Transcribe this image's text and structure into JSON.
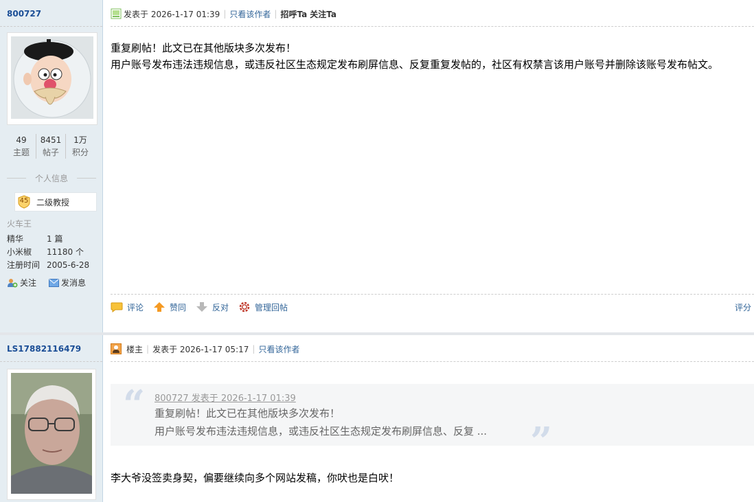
{
  "post1": {
    "author": {
      "username": "800727",
      "stats": [
        {
          "value": "49",
          "label": "主题"
        },
        {
          "value": "8451",
          "label": "帖子"
        },
        {
          "value": "1万",
          "label": "积分"
        }
      ],
      "section_header": "个人信息",
      "rank_level": "45",
      "rank_name": "二级教授",
      "title": "火车王",
      "info": [
        {
          "key": "精华",
          "value": "1 篇"
        },
        {
          "key": "小米椒",
          "value": "11180 个"
        },
        {
          "key": "注册时间",
          "value": "2005-6-28"
        }
      ],
      "follow_label": "关注",
      "message_label": "发消息"
    },
    "posted_at": "发表于 2026-1-17 01:39",
    "only_author": "只看该作者",
    "greet": "招呼Ta",
    "follow": "关注Ta",
    "body_lines": [
      "重复刷帖！此文已在其他版块多次发布！",
      "用户账号发布违法违规信息，或违反社区生态规定发布刷屏信息、反复重复发帖的，社区有权禁言该用户账号并删除该账号发布帖文。"
    ],
    "footer": {
      "comment": "评论",
      "like": "赞同",
      "oppose": "反对",
      "manage": "管理回帖",
      "rate": "评分"
    }
  },
  "post2": {
    "author": {
      "username": "LS17882116479"
    },
    "role": "楼主",
    "posted_at": "发表于 2026-1-17 05:17",
    "only_author": "只看该作者",
    "quote": {
      "meta": "800727 发表于 2026-1-17 01:39",
      "line1": "重复刷帖！此文已在其他版块多次发布！",
      "line2": "用户账号发布违法违规信息，或违反社区生态规定发布刷屏信息、反复 ..."
    },
    "body": "李大爷没签卖身契，偏要继续向多个网站发稿，你吠也是白吠！"
  },
  "icons": {
    "post_icon": "document-icon",
    "owner_icon": "thread-owner-icon",
    "comment_icon": "comment-icon",
    "like_icon": "thumb-up-arrow-icon",
    "oppose_icon": "thumb-down-arrow-icon",
    "manage_icon": "gear-icon"
  },
  "colors": {
    "link": "#336699",
    "username": "#1b4e96",
    "sidebar_bg": "#e5edf2"
  }
}
